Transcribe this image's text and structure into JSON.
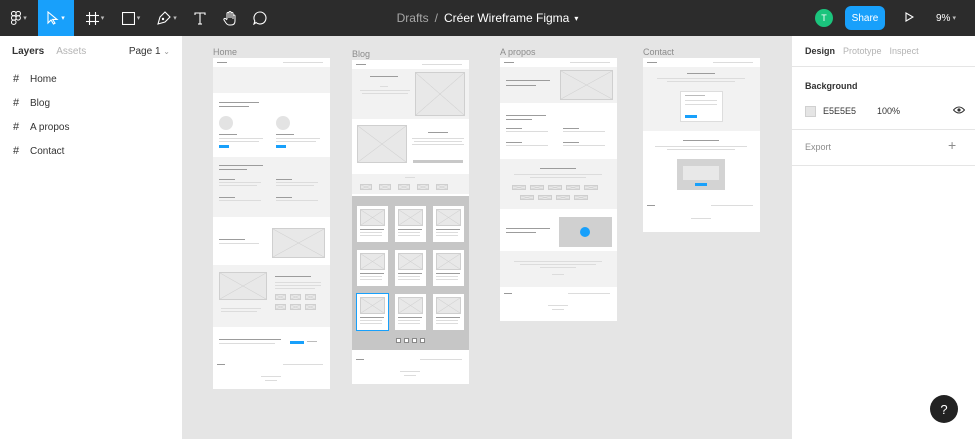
{
  "topbar": {
    "breadcrumb_folder": "Drafts",
    "breadcrumb_sep": "/",
    "file_name": "Créer Wireframe Figma",
    "avatar_initial": "T",
    "share_label": "Share",
    "zoom_label": "9%",
    "tools": [
      "figma-menu-icon",
      "move-tool-icon",
      "frame-tool-icon",
      "shape-tool-icon",
      "pen-tool-icon",
      "text-tool-icon",
      "hand-tool-icon",
      "comment-tool-icon"
    ],
    "accent": "#18a0fb"
  },
  "left_panel": {
    "tab_layers": "Layers",
    "tab_assets": "Assets",
    "page_select": "Page 1",
    "layers": [
      {
        "label": "Home"
      },
      {
        "label": "Blog"
      },
      {
        "label": "A propos"
      },
      {
        "label": "Contact"
      }
    ]
  },
  "canvas": {
    "background": "#e5e5e5",
    "frames": [
      {
        "label": "Home"
      },
      {
        "label": "Blog"
      },
      {
        "label": "A propos"
      },
      {
        "label": "Contact"
      }
    ]
  },
  "right_panel": {
    "tab_design": "Design",
    "tab_prototype": "Prototype",
    "tab_inspect": "Inspect",
    "background_title": "Background",
    "background_hex": "E5E5E5",
    "background_opacity": "100%",
    "export_title": "Export",
    "export_add": "+",
    "help_label": "?"
  }
}
